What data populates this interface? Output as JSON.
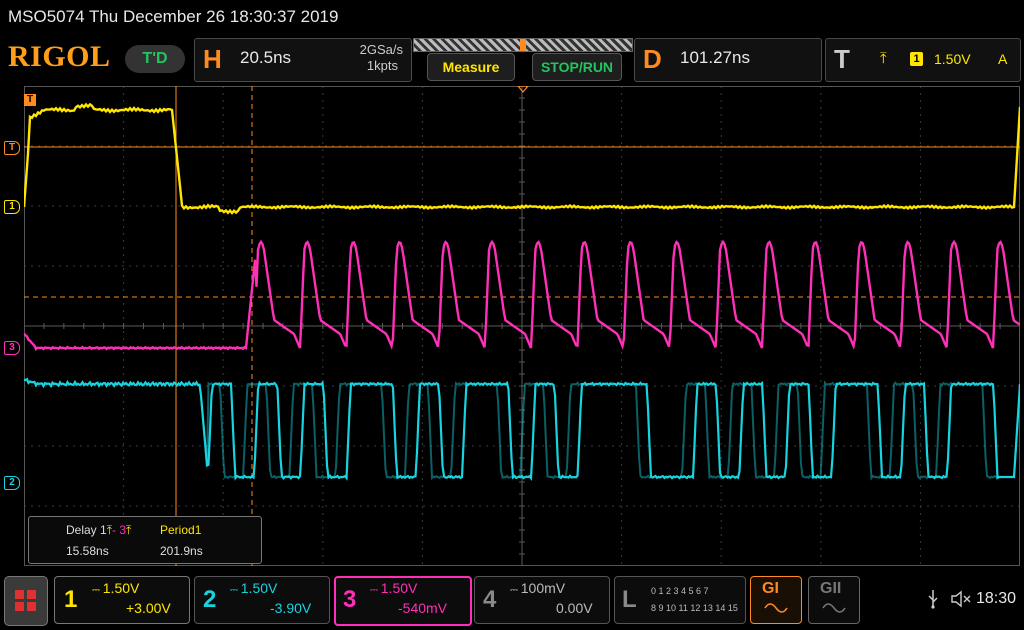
{
  "title": "MSO5074  Thu December 26 18:30:37 2019",
  "logo": "RIGOL",
  "trigger_status": "T'D",
  "horizontal": {
    "letter": "H",
    "timebase": "20.5ns",
    "sample_rate": "2GSa/s",
    "points": "1kpts"
  },
  "buttons": {
    "measure": "Measure",
    "stop_run": "STOP/RUN"
  },
  "delay": {
    "letter": "D",
    "value": "101.27ns"
  },
  "trigger": {
    "letter": "T",
    "edge_symbol": "⤒",
    "source": "1",
    "level": "1.50V",
    "mode": "A"
  },
  "memory": {
    "position": 0.5
  },
  "markers": {
    "trigger_top": "T",
    "trigger_level": "T",
    "ch1": "1",
    "ch3": "3",
    "ch2": "2"
  },
  "measurement": {
    "delay_label": "Delay 1",
    "delay_mid": "- 3",
    "delay_value": "15.58ns",
    "period_label": "Period1",
    "period_value": "201.9ns"
  },
  "channels": [
    {
      "num": "1",
      "scale": "1.50V",
      "offset": "+3.00V",
      "color": "#ffe600"
    },
    {
      "num": "2",
      "scale": "1.50V",
      "offset": "-3.90V",
      "color": "#17d4e0"
    },
    {
      "num": "3",
      "scale": "1.50V",
      "offset": "-540mV",
      "color": "#ff2fb8"
    },
    {
      "num": "4",
      "scale": "100mV",
      "offset": "0.00V",
      "color": "#8a8a8a"
    }
  ],
  "la": {
    "letter": "L",
    "row1": "0 1 2 3  4 5 6 7",
    "row2": "8 9 10 11 12 13 14 15"
  },
  "generators": {
    "gi": "GI",
    "gii": "GII"
  },
  "status": {
    "usb_icon": "usb-icon",
    "volume_icon": "speaker-mute-icon",
    "time": "18:30"
  },
  "colors": {
    "accent": "#ff8a1e",
    "ch1": "#ffe600",
    "ch2": "#17d4e0",
    "ch3": "#ff2fb8",
    "cursor": "#ff8a1e"
  }
}
